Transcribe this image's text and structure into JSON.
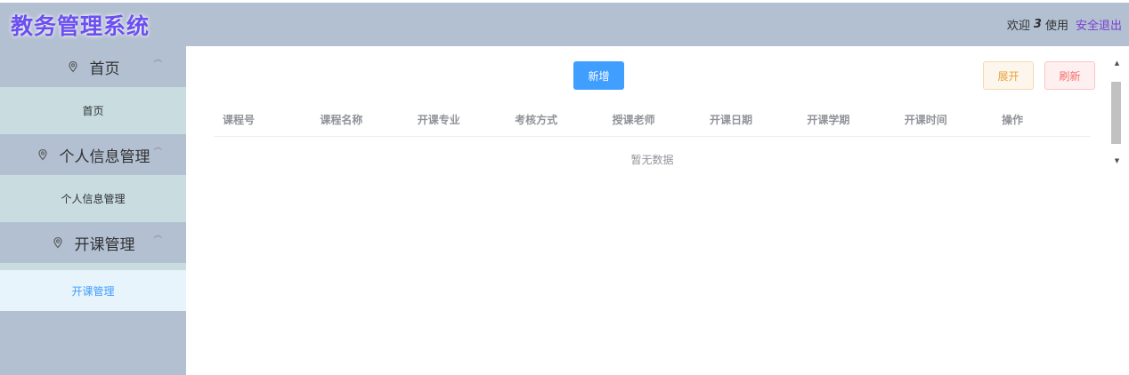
{
  "header": {
    "app_title": "教务管理系统",
    "welcome_text": "欢迎",
    "user_count": "3",
    "use_text": "使用",
    "logout_label": "安全退出"
  },
  "sidebar": {
    "groups": [
      {
        "title": "首页",
        "items": [
          {
            "label": "首页"
          }
        ]
      },
      {
        "title": "个人信息管理",
        "items": [
          {
            "label": "个人信息管理"
          }
        ]
      },
      {
        "title": "开课管理",
        "items": [
          {
            "label": "开课管理"
          }
        ]
      }
    ],
    "icons": {
      "group": "location-pin-icon",
      "collapse": "chevron-up-icon"
    },
    "active_item": "开课管理"
  },
  "toolbar": {
    "add_label": "新增",
    "expand_label": "展开",
    "refresh_label": "刷新"
  },
  "table": {
    "columns": [
      "课程号",
      "课程名称",
      "开课专业",
      "考核方式",
      "授课老师",
      "开课日期",
      "开课学期",
      "开课时间",
      "操作"
    ],
    "rows": [],
    "empty_text": "暂无数据"
  },
  "colors": {
    "header_bg": "#b3c0d1",
    "submenu_bg": "#c9dde0",
    "active_item_bg": "#e8f4fb",
    "primary": "#409eff",
    "warning": "#e6a23c",
    "danger": "#f56c6c",
    "logo": "#6b4ff0"
  }
}
